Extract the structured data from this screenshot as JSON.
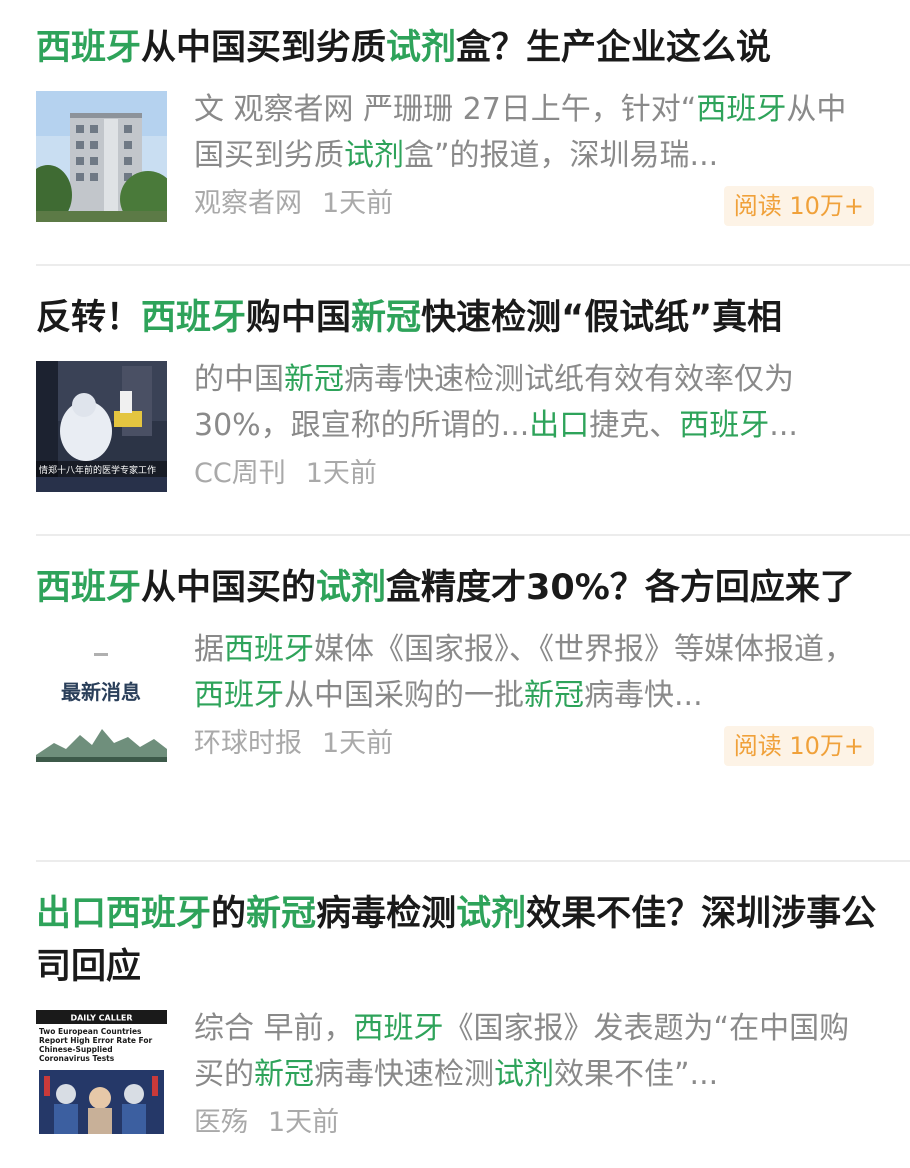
{
  "articles": [
    {
      "title_segments": [
        {
          "text": "西班牙",
          "hl": true
        },
        {
          "text": "从中国买到劣质",
          "hl": false
        },
        {
          "text": "试剂",
          "hl": true
        },
        {
          "text": "盒？生产企业这么说",
          "hl": false
        }
      ],
      "thumb_icon": "building-photo",
      "excerpt_segments": [
        {
          "text": "文 观察者网 严珊珊 27日上午，针对“",
          "hl": false
        },
        {
          "text": "西班牙",
          "hl": true
        },
        {
          "text": "从中国买到劣质",
          "hl": false
        },
        {
          "text": "试剂",
          "hl": true
        },
        {
          "text": "盒”的报道，深圳易瑞...",
          "hl": false
        }
      ],
      "source": "观察者网",
      "time": "1天前",
      "read_badge": "阅读 10万+"
    },
    {
      "title_segments": [
        {
          "text": "反转！",
          "hl": false
        },
        {
          "text": "西班牙",
          "hl": true
        },
        {
          "text": "购中国",
          "hl": false
        },
        {
          "text": "新冠",
          "hl": true
        },
        {
          "text": "快速检测“假试纸”真相",
          "hl": false
        }
      ],
      "thumb_icon": "medical-worker-photo",
      "thumb_caption": "情郑十八年前的医学专家工作",
      "excerpt_segments": [
        {
          "text": "的中国",
          "hl": false
        },
        {
          "text": "新冠",
          "hl": true
        },
        {
          "text": "病毒快速检测试纸有效有效率仅为30%，跟宣称的所谓的...",
          "hl": false
        },
        {
          "text": "出口",
          "hl": true
        },
        {
          "text": "捷克、",
          "hl": false
        },
        {
          "text": "西班牙",
          "hl": true
        },
        {
          "text": "...",
          "hl": false
        }
      ],
      "source": "CC周刊",
      "time": "1天前",
      "read_badge": ""
    },
    {
      "title_segments": [
        {
          "text": "西班牙",
          "hl": true
        },
        {
          "text": "从中国买的",
          "hl": false
        },
        {
          "text": "试剂",
          "hl": true
        },
        {
          "text": "盒精度才30%？各方回应来了",
          "hl": false
        }
      ],
      "thumb_icon": "latest-news-graphic",
      "thumb_caption": "最新消息",
      "excerpt_segments": [
        {
          "text": "据",
          "hl": false
        },
        {
          "text": "西班牙",
          "hl": true
        },
        {
          "text": "媒体《国家报》、《世界报》等媒体报道，",
          "hl": false
        },
        {
          "text": "西班牙",
          "hl": true
        },
        {
          "text": "从中国采购的一批",
          "hl": false
        },
        {
          "text": "新冠",
          "hl": true
        },
        {
          "text": "病毒快...",
          "hl": false
        }
      ],
      "source": "环球时报",
      "time": "1天前",
      "read_badge": "阅读 10万+"
    },
    {
      "title_segments": [
        {
          "text": "出口",
          "hl": true
        },
        {
          "text": "西班牙",
          "hl": true
        },
        {
          "text": "的",
          "hl": false
        },
        {
          "text": "新冠",
          "hl": true
        },
        {
          "text": "病毒检测",
          "hl": false
        },
        {
          "text": "试剂",
          "hl": true
        },
        {
          "text": "效果不佳？深圳涉事公司回应",
          "hl": false
        }
      ],
      "thumb_icon": "daily-caller-screenshot",
      "thumb_brand": "DAILY CALLER",
      "thumb_headline": "Two European Countries Report High Error Rate For Chinese-Supplied Coronavirus Tests",
      "excerpt_segments": [
        {
          "text": "综合 早前，",
          "hl": false
        },
        {
          "text": "西班牙",
          "hl": true
        },
        {
          "text": "《国家报》发表题为“在中国购买的",
          "hl": false
        },
        {
          "text": "新冠",
          "hl": true
        },
        {
          "text": "病毒快速检测",
          "hl": false
        },
        {
          "text": "试剂",
          "hl": true
        },
        {
          "text": "效果不佳”...",
          "hl": false
        }
      ],
      "source": "医殇",
      "time": "1天前",
      "read_badge": ""
    }
  ],
  "colors": {
    "highlight": "#2ea35a",
    "badge_text": "#f0a13a",
    "badge_bg": "#fdf3e6"
  }
}
